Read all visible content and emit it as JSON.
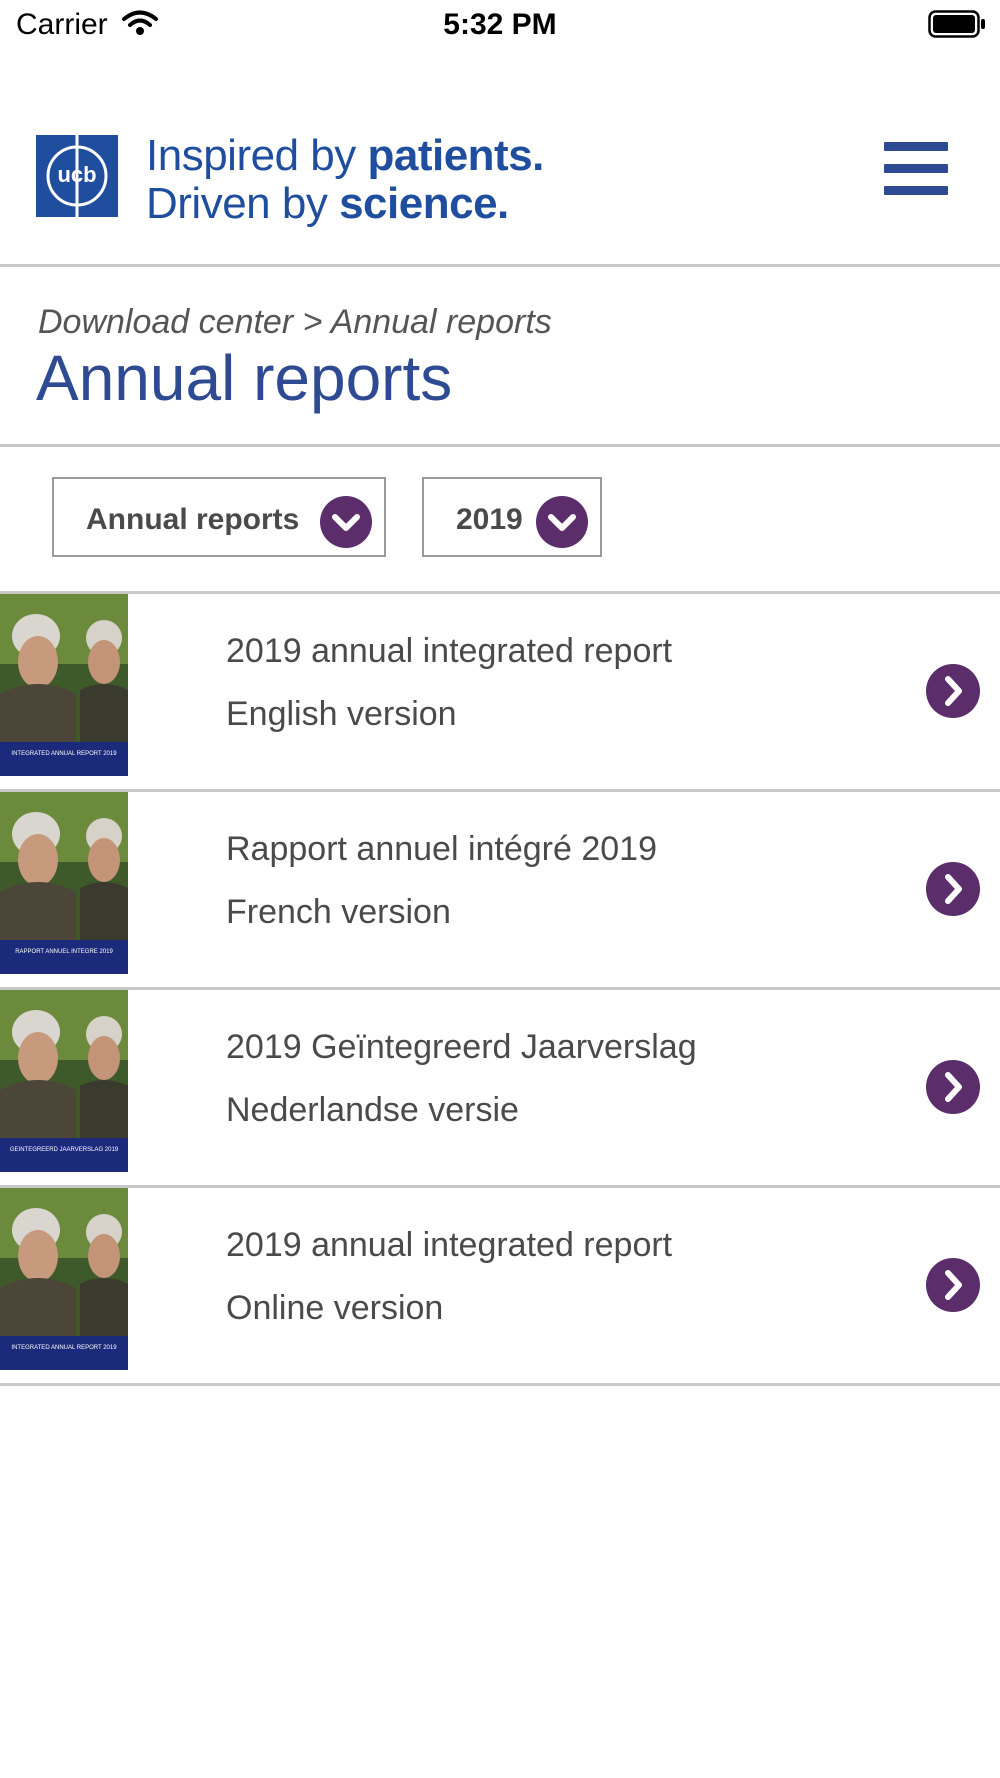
{
  "status_bar": {
    "carrier": "Carrier",
    "time": "5:32 PM"
  },
  "header": {
    "logo_text": "ucb",
    "tagline_line1_regular": "Inspired by ",
    "tagline_line1_bold": "patients.",
    "tagline_line2_regular": "Driven by ",
    "tagline_line2_bold": "science.",
    "menu_icon": "hamburger-menu-icon"
  },
  "breadcrumb": "Download center > Annual reports",
  "page_title": "Annual reports",
  "filters": {
    "category": {
      "selected": "Annual reports",
      "icon": "chevron-down-icon"
    },
    "year": {
      "selected": "2019",
      "icon": "chevron-down-icon"
    }
  },
  "reports": [
    {
      "title": "2019 annual integrated report",
      "subtitle": "English version",
      "cover_caption": "INTEGRATED ANNUAL REPORT 2019"
    },
    {
      "title": "Rapport annuel intégré 2019",
      "subtitle": "French version",
      "cover_caption": "RAPPORT ANNUEL INTEGRE 2019"
    },
    {
      "title": "2019 Geïntegreerd Jaarverslag",
      "subtitle": "Nederlandse versie",
      "cover_caption": "GEINTEGREERD JAARVERSLAG 2019"
    },
    {
      "title": "2019 annual integrated report",
      "subtitle": "Online version",
      "cover_caption": "INTEGRATED ANNUAL REPORT 2019"
    }
  ],
  "colors": {
    "brand_blue": "#2e4a93",
    "accent_purple": "#5b2d6b",
    "divider": "#c8c8c8"
  }
}
